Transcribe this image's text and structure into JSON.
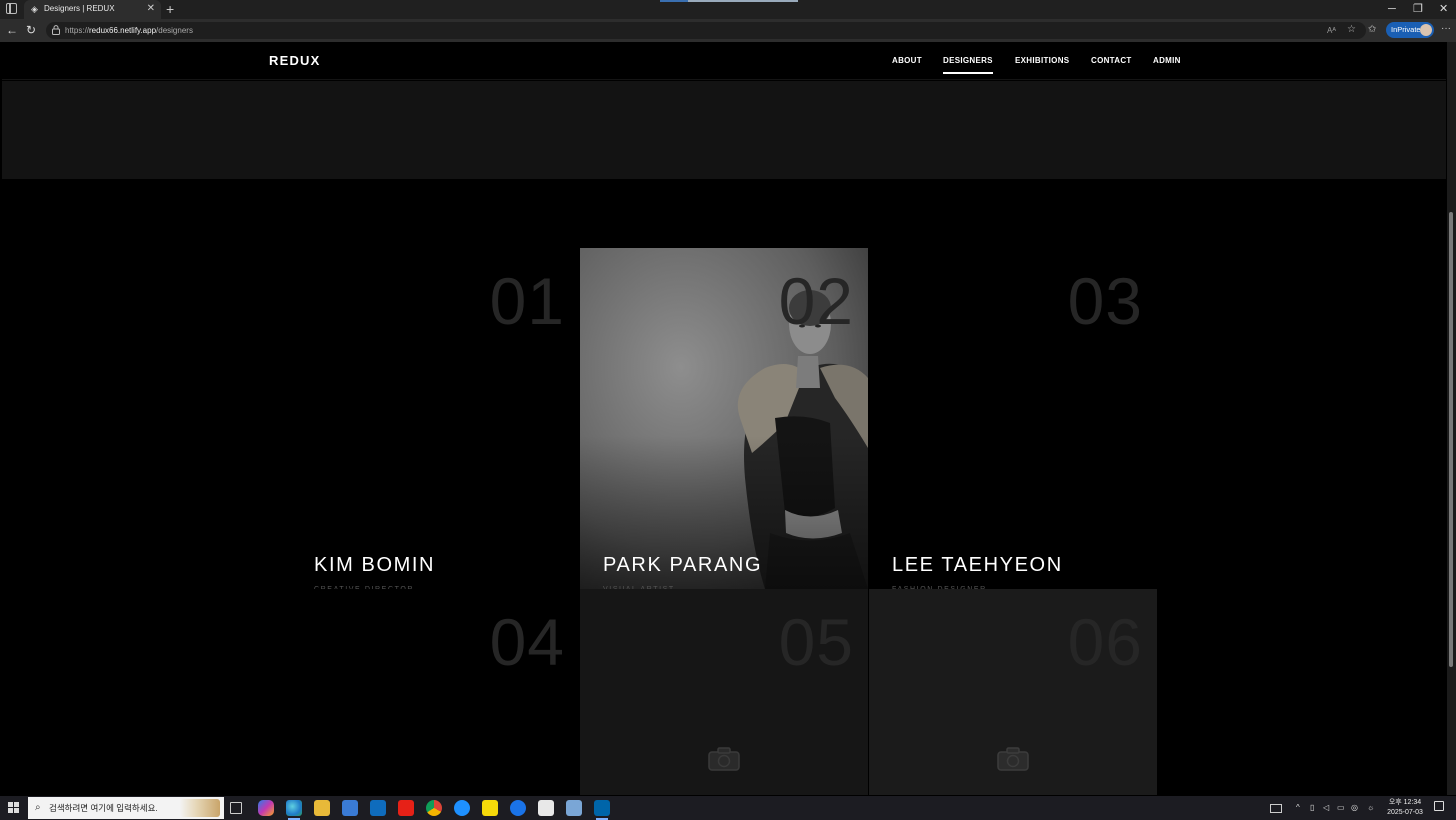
{
  "browser": {
    "tab_title": "Designers | REDUX",
    "tab_favicon": "◈",
    "tab_close": "✕",
    "new_tab": "+",
    "url_prefix": "https://",
    "url_host": "redux66.netlify.app",
    "url_path": "/designers",
    "read_aloud": "Aᴬ",
    "inprivate_label": "InPrivate",
    "win_minimize": "─",
    "win_restore": "❐",
    "win_close": "✕",
    "back": "←",
    "refresh": "↻",
    "star": "☆",
    "favorites": "✩",
    "more": "···"
  },
  "site": {
    "logo": "REDUX",
    "nav": [
      {
        "label": "ABOUT",
        "active": false
      },
      {
        "label": "DESIGNERS",
        "active": true
      },
      {
        "label": "EXHIBITIONS",
        "active": false
      },
      {
        "label": "CONTACT",
        "active": false
      },
      {
        "label": "ADMIN",
        "active": false
      }
    ]
  },
  "designers": [
    {
      "num": "01",
      "name": "KIM BOMIN",
      "role": "CREATIVE DIRECTOR",
      "has_photo": false
    },
    {
      "num": "02",
      "name": "PARK PARANG",
      "role": "VISUAL ARTIST",
      "has_photo": true
    },
    {
      "num": "03",
      "name": "LEE TAEHYEON",
      "role": "FASHION DESIGNER",
      "has_photo": false
    },
    {
      "num": "04",
      "name": "",
      "role": "",
      "has_photo": false
    },
    {
      "num": "05",
      "name": "",
      "role": "",
      "has_photo": false,
      "placeholder_icon": "camera-icon"
    },
    {
      "num": "06",
      "name": "",
      "role": "",
      "has_photo": false,
      "placeholder_icon": "camera-icon"
    }
  ],
  "taskbar": {
    "search_placeholder": "검색하려면 여기에 입력하세요.",
    "clock_time": "오후 12:34",
    "clock_date": "2025-07-03"
  }
}
